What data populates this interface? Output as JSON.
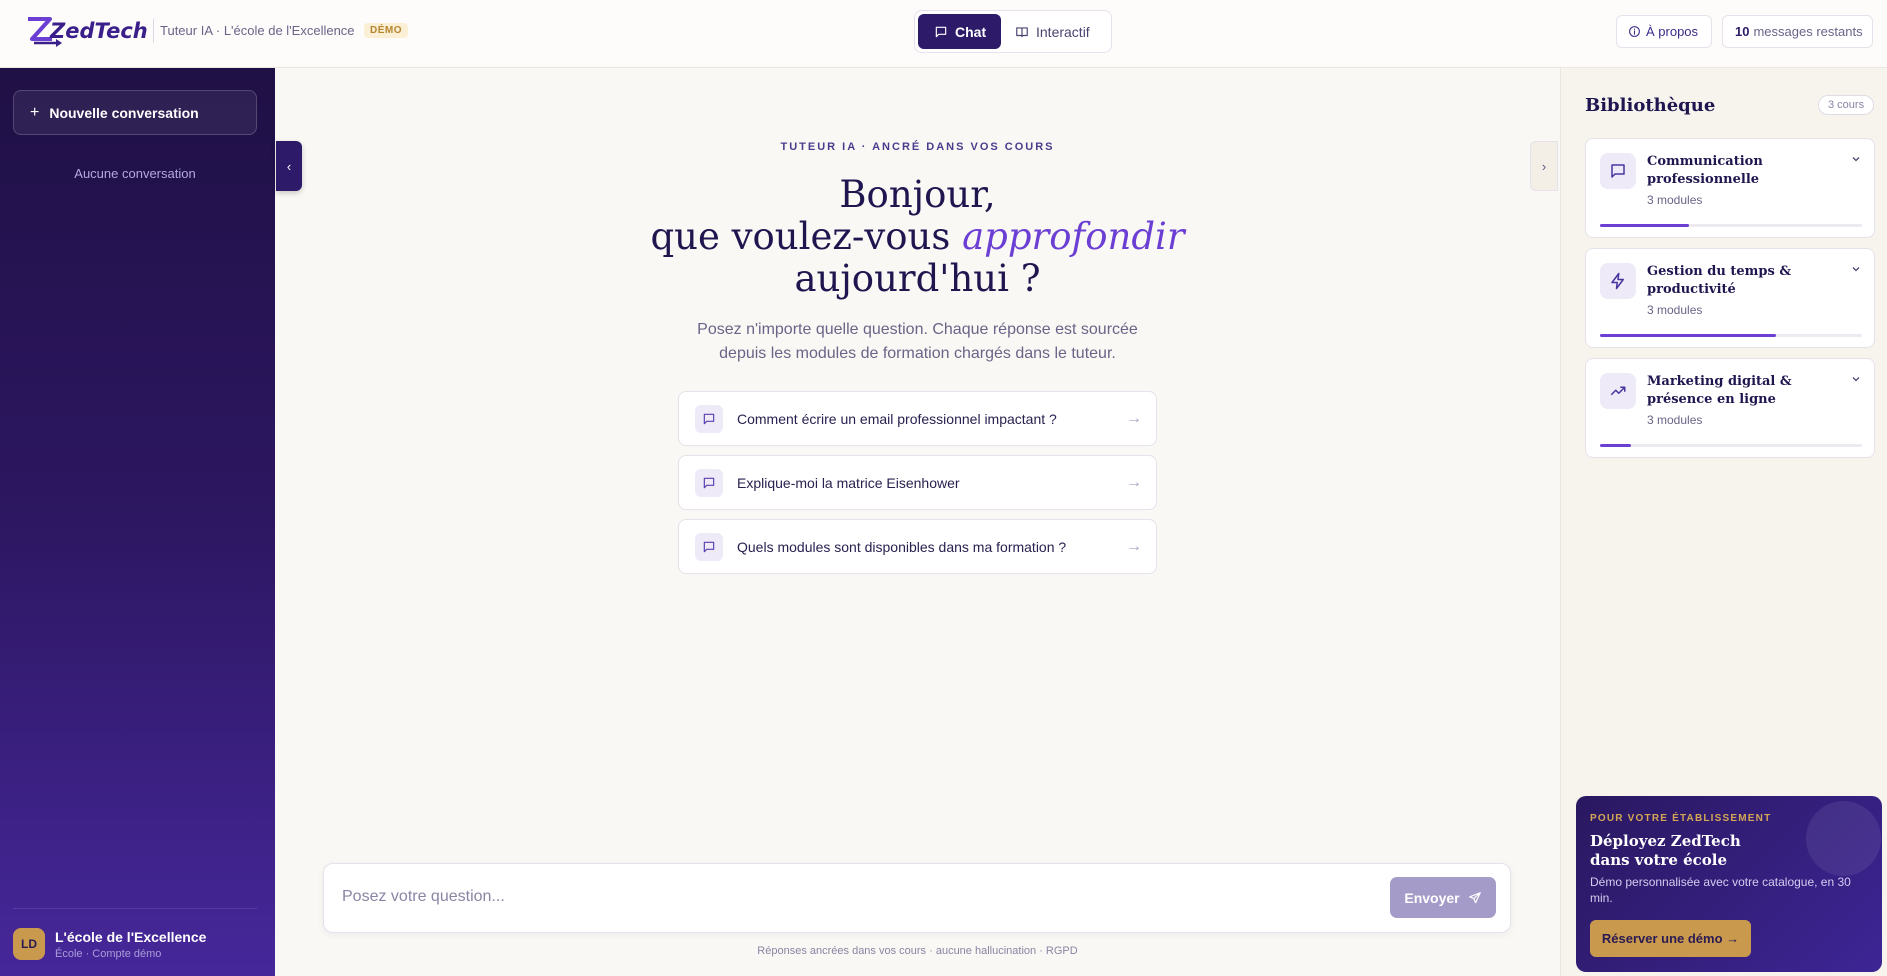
{
  "header": {
    "logo": "ZedTech",
    "subtitle": "Tuteur IA · L'école de l'Excellence",
    "badge": "DÉMO",
    "modes": [
      {
        "label": "Chat",
        "active": true
      },
      {
        "label": "Interactif",
        "active": false
      }
    ],
    "about": "À propos",
    "messages_count": "10",
    "messages_label": "messages restants"
  },
  "sidebar": {
    "new_conversation": "Nouvelle conversation",
    "empty": "Aucune conversation",
    "school": {
      "initials": "LD",
      "name": "L'école de l'Excellence",
      "role": "École · Compte démo"
    }
  },
  "main": {
    "eyebrow": "TUTEUR IA · ANCRÉ DANS VOS COURS",
    "title_line1": "Bonjour,",
    "title_line2_a": "que voulez-vous ",
    "title_line2_em": "approfondir",
    "title_line3": "aujourd'hui ?",
    "subtitle_line1": "Posez n'importe quelle question. Chaque réponse est sourcée",
    "subtitle_line2": "depuis les modules de formation chargés dans le tuteur.",
    "suggestions": [
      "Comment écrire un email professionnel impactant ?",
      "Explique-moi la matrice Eisenhower",
      "Quels modules sont disponibles dans ma formation ?"
    ],
    "input_placeholder": "Posez votre question...",
    "send": "Envoyer",
    "footnote": "Réponses ancrées dans vos cours · aucune hallucination · RGPD"
  },
  "library": {
    "title": "Bibliothèque",
    "count": "3 cours",
    "courses": [
      {
        "title": "Communication professionnelle",
        "modules": "3 modules",
        "icon": "message-square-icon",
        "progress": 0.34
      },
      {
        "title": "Gestion du temps & productivité",
        "modules": "3 modules",
        "icon": "zap-icon",
        "progress": 0.67
      },
      {
        "title": "Marketing digital & présence en ligne",
        "modules": "3 modules",
        "icon": "trending-up-icon",
        "progress": 0.12
      }
    ]
  },
  "cta": {
    "eyebrow": "POUR VOTRE ÉTABLISSEMENT",
    "title_line1": "Déployez ZedTech",
    "title_line2": "dans votre école",
    "description": "Démo personnalisée avec votre catalogue, en 30 min.",
    "button": "Réserver une démo →"
  },
  "colors": {
    "primary": "#2d1b69",
    "accent": "#6b3fd4",
    "gold": "#c99a4e"
  }
}
